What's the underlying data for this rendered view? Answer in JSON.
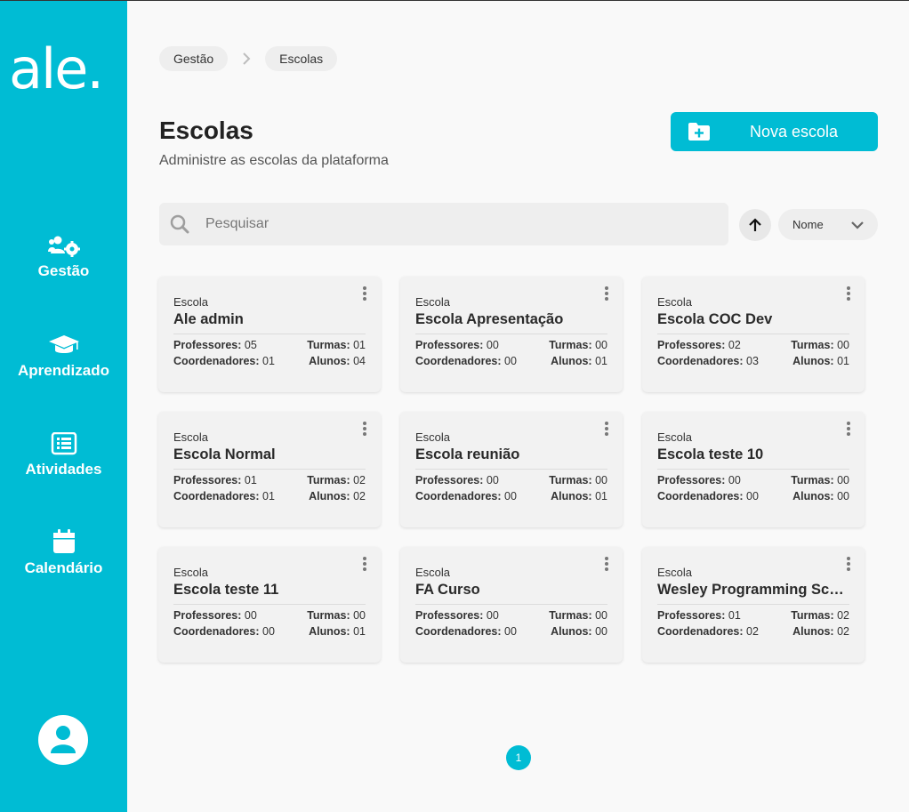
{
  "brand": {
    "logo_text": "ale.",
    "accent_color": "#00bcd4"
  },
  "sidebar": {
    "items": [
      {
        "label": "Gestão",
        "icon": "users-gear-icon"
      },
      {
        "label": "Aprendizado",
        "icon": "graduation-cap-icon"
      },
      {
        "label": "Atividades",
        "icon": "list-icon"
      },
      {
        "label": "Calendário",
        "icon": "calendar-icon"
      }
    ],
    "avatar_icon": "user-icon"
  },
  "breadcrumb": [
    "Gestão",
    "Escolas"
  ],
  "header": {
    "title": "Escolas",
    "subtitle": "Administre as escolas da plataforma",
    "new_button_label": "Nova escola"
  },
  "search": {
    "placeholder": "Pesquisar",
    "value": ""
  },
  "sort": {
    "direction": "asc",
    "field": "Nome"
  },
  "schools": [
    {
      "kind": "Escola",
      "name": "Ale admin",
      "professores_label": "Professores:",
      "professores": "05",
      "turmas_label": "Turmas:",
      "turmas": "01",
      "coordenadores_label": "Coordenadores:",
      "coordenadores": "01",
      "alunos_label": "Alunos:",
      "alunos": "04"
    },
    {
      "kind": "Escola",
      "name": "Escola Apresentação",
      "professores_label": "Professores:",
      "professores": "00",
      "turmas_label": "Turmas:",
      "turmas": "00",
      "coordenadores_label": "Coordenadores:",
      "coordenadores": "00",
      "alunos_label": "Alunos:",
      "alunos": "01"
    },
    {
      "kind": "Escola",
      "name": "Escola COC Dev",
      "professores_label": "Professores:",
      "professores": "02",
      "turmas_label": "Turmas:",
      "turmas": "00",
      "coordenadores_label": "Coordenadores:",
      "coordenadores": "03",
      "alunos_label": "Alunos:",
      "alunos": "01"
    },
    {
      "kind": "Escola",
      "name": "Escola Normal",
      "professores_label": "Professores:",
      "professores": "01",
      "turmas_label": "Turmas:",
      "turmas": "02",
      "coordenadores_label": "Coordenadores:",
      "coordenadores": "01",
      "alunos_label": "Alunos:",
      "alunos": "02"
    },
    {
      "kind": "Escola",
      "name": "Escola reunião",
      "professores_label": "Professores:",
      "professores": "00",
      "turmas_label": "Turmas:",
      "turmas": "00",
      "coordenadores_label": "Coordenadores:",
      "coordenadores": "00",
      "alunos_label": "Alunos:",
      "alunos": "01"
    },
    {
      "kind": "Escola",
      "name": "Escola teste 10",
      "professores_label": "Professores:",
      "professores": "00",
      "turmas_label": "Turmas:",
      "turmas": "00",
      "coordenadores_label": "Coordenadores:",
      "coordenadores": "00",
      "alunos_label": "Alunos:",
      "alunos": "00"
    },
    {
      "kind": "Escola",
      "name": "Escola teste 11",
      "professores_label": "Professores:",
      "professores": "00",
      "turmas_label": "Turmas:",
      "turmas": "00",
      "coordenadores_label": "Coordenadores:",
      "coordenadores": "00",
      "alunos_label": "Alunos:",
      "alunos": "01"
    },
    {
      "kind": "Escola",
      "name": "FA Curso",
      "professores_label": "Professores:",
      "professores": "00",
      "turmas_label": "Turmas:",
      "turmas": "00",
      "coordenadores_label": "Coordenadores:",
      "coordenadores": "00",
      "alunos_label": "Alunos:",
      "alunos": "00"
    },
    {
      "kind": "Escola",
      "name": "Wesley Programming School",
      "professores_label": "Professores:",
      "professores": "01",
      "turmas_label": "Turmas:",
      "turmas": "02",
      "coordenadores_label": "Coordenadores:",
      "coordenadores": "02",
      "alunos_label": "Alunos:",
      "alunos": "02"
    }
  ],
  "pagination": {
    "current_page": "1"
  }
}
